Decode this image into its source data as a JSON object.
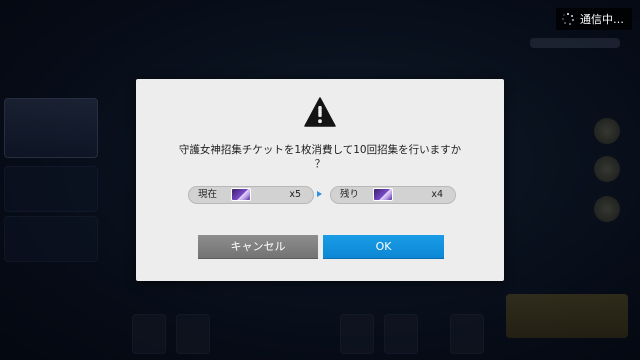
{
  "status": {
    "text": "通信中…",
    "icon": "loading-spinner-icon"
  },
  "dialog": {
    "icon": "warning-icon",
    "message_line1": "守護女神招集チケットを1枚消費して10回招集を行いますか",
    "message_line2": "？",
    "current": {
      "label": "現在",
      "icon": "summon-ticket-icon",
      "count": "x5"
    },
    "remaining": {
      "label": "残り",
      "icon": "summon-ticket-icon",
      "count": "x4"
    },
    "arrow_icon": "arrow-right-icon",
    "cancel_label": "キャンセル",
    "ok_label": "OK"
  },
  "colors": {
    "ok_button": "#0c86d4",
    "cancel_button": "#7d7d7d",
    "dialog_bg": "#ededed",
    "arrow": "#2f8fe0"
  }
}
